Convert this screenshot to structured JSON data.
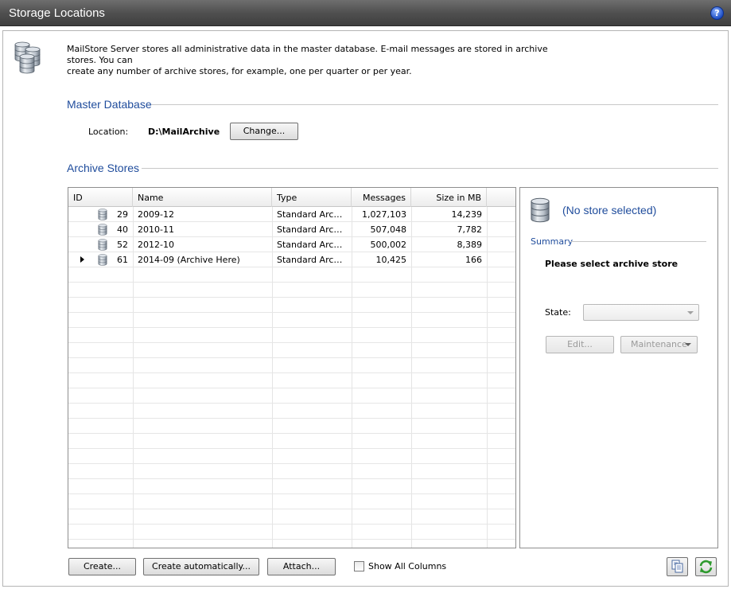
{
  "window": {
    "title": "Storage Locations"
  },
  "intro": {
    "line1": "MailStore Server stores all administrative data in the master database. E-mail messages are stored in archive stores. You can",
    "line2": "create any number of archive stores, for example, one per quarter or per year."
  },
  "master_database": {
    "title": "Master Database",
    "location_label": "Location:",
    "location_value": "D:\\MailArchive",
    "change_label": "Change..."
  },
  "archive_stores": {
    "title": "Archive Stores",
    "columns": [
      "ID",
      "Name",
      "Type",
      "Messages",
      "Size in MB"
    ],
    "rows": [
      {
        "id": "29",
        "name": "2009-12",
        "type": "Standard Archi...",
        "messages": "1,027,103",
        "size": "14,239"
      },
      {
        "id": "40",
        "name": "2010-11",
        "type": "Standard Archi...",
        "messages": "507,048",
        "size": "7,782"
      },
      {
        "id": "52",
        "name": "2012-10",
        "type": "Standard Archi...",
        "messages": "500,002",
        "size": "8,389"
      },
      {
        "id": "61",
        "name": "2014-09 (Archive Here)",
        "type": "Standard Archi...",
        "messages": "10,425",
        "size": "166"
      }
    ]
  },
  "details": {
    "title": "(No store selected)",
    "summary_label": "Summary",
    "select_message": "Please select archive store",
    "state_label": "State:",
    "state_value": "",
    "edit_label": "Edit...",
    "maintenance_label": "Maintenance"
  },
  "footer": {
    "create_label": "Create...",
    "create_auto_label": "Create automatically...",
    "attach_label": "Attach...",
    "show_all_columns_label": "Show All Columns",
    "show_all_columns_checked": false
  },
  "colors": {
    "accent": "#1f4c9c",
    "titlebar": "#505050"
  }
}
